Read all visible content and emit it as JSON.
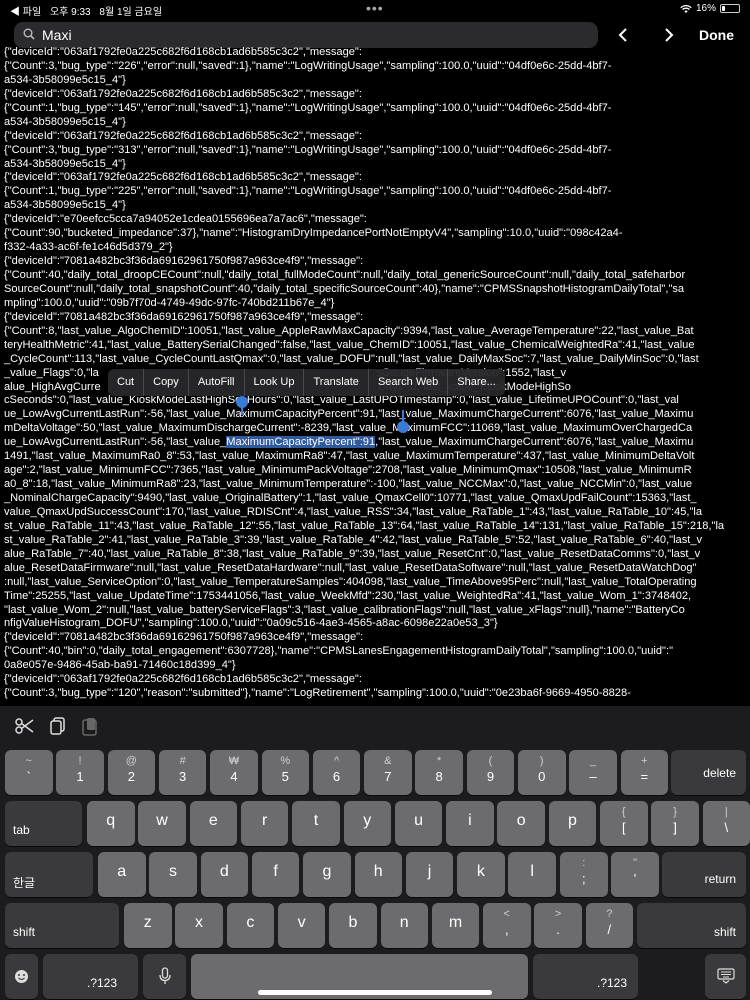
{
  "status_bar": {
    "back_app": "◀ 파일",
    "time": "오후 9:33",
    "date": "8월 1일 금요일",
    "battery": "16%",
    "battery_level": 0.16
  },
  "find_bar": {
    "query": "Maxi",
    "done_label": "Done"
  },
  "log_lines": [
    "{\"deviceId\":\"063af1792fe0a225c682f6d168cb1ad6b585c3c2\",\"message\":",
    "{\"Count\":3,\"bug_type\":\"226\",\"error\":null,\"saved\":1},\"name\":\"LogWritingUsage\",\"sampling\":100.0,\"uuid\":\"04df0e6c-25dd-4bf7-",
    "a534-3b58099e5c15_4\"}",
    "{\"deviceId\":\"063af1792fe0a225c682f6d168cb1ad6b585c3c2\",\"message\":",
    "{\"Count\":1,\"bug_type\":\"145\",\"error\":null,\"saved\":1},\"name\":\"LogWritingUsage\",\"sampling\":100.0,\"uuid\":\"04df0e6c-25dd-4bf7-",
    "a534-3b58099e5c15_4\"}",
    "{\"deviceId\":\"063af1792fe0a225c682f6d168cb1ad6b585c3c2\",\"message\":",
    "{\"Count\":3,\"bug_type\":\"313\",\"error\":null,\"saved\":1},\"name\":\"LogWritingUsage\",\"sampling\":100.0,\"uuid\":\"04df0e6c-25dd-4bf7-",
    "a534-3b58099e5c15_4\"}",
    "{\"deviceId\":\"063af1792fe0a225c682f6d168cb1ad6b585c3c2\",\"message\":",
    "{\"Count\":1,\"bug_type\":\"225\",\"error\":null,\"saved\":1},\"name\":\"LogWritingUsage\",\"sampling\":100.0,\"uuid\":\"04df0e6c-25dd-4bf7-",
    "a534-3b58099e5c15_4\"}",
    "{\"deviceId\":\"e70eefcc5cca7a94052e1cdea0155696ea7a7ac6\",\"message\":",
    "{\"Count\":90,\"bucketed_impedance\":37},\"name\":\"HistogramDryImpedancePortNotEmptyV4\",\"sampling\":10.0,\"uuid\":\"098c42a4-",
    "f332-4a33-ac6f-fe1c46d5d379_2\"}",
    "{\"deviceId\":\"7081a482bc3f36da69162961750f987a963ce4f9\",\"message\":",
    "{\"Count\":40,\"daily_total_droopCECount\":null,\"daily_total_fullModeCount\":null,\"daily_total_genericSourceCount\":null,\"daily_total_safeharbor",
    "SourceCount\":null,\"daily_total_snapshotCount\":40,\"daily_total_specificSourceCount\":40},\"name\":\"CPMSSnapshotHistogramDailyTotal\",\"sa",
    "mpling\":100.0,\"uuid\":\"09b7f70d-4749-49dc-97fc-740bd211b67e_4\"}",
    "{\"deviceId\":\"7081a482bc3f36da69162961750f987a963ce4f9\",\"message\":",
    "{\"Count\":8,\"last_value_AlgoChemID\":10051,\"last_value_AppleRawMaxCapacity\":9394,\"last_value_AverageTemperature\":22,\"last_value_Bat",
    "teryHealthMetric\":41,\"last_value_BatterySerialChanged\":false,\"last_value_ChemID\":10051,\"last_value_ChemicalWeightedRa\":41,\"last_value",
    "_CycleCount\":113,\"last_value_CycleCountLastQmax\":0,\"last_value_DOFU\":null,\"last_value_DailyMaxSoc\":7,\"last_value_DailyMinSoc\":0,\"last",
    "_value_Flags\":0,\"la                                                                                          sGaugeFirmwareVersion\":1552,\"last_v",
    "alue_HighAvgCurre                                                                                          Days\":0,\"last_value_KioskModeHighSo",
    "cSeconds\":0,\"last_value_KioskModeLastHighSocHours\":0,\"last_value_LastUPOTimestamp\":0,\"last_value_LifetimeUPOCount\":0,\"last_val",
    "ue_LowAvgCurrentLastRun\":-56,\"last_value_MaximumCapacityPercent\":91,\"last_value_MaximumChargeCurrent\":6076,\"last_value_Maximu",
    "mDeltaVoltage\":50,\"last_value_MaximumDischargeCurrent\":-8239,\"last_value_MaximumFCC\":11069,\"last_value_MaximumOverChargedCa",
    "pacity\":1599,\"last_value_MaximumOverDischargedCapacity\":-802,\"last_value_MaximumPackVoltage\":4402,\"last_value_MaximumQmax\":1",
    "1491,\"last_value_MaximumRa0_8\":53,\"last_value_MaximumRa8\":47,\"last_value_MaximumTemperature\":437,\"last_value_MinimumDeltaVolt",
    "age\":2,\"last_value_MinimumFCC\":7365,\"last_value_MinimumPackVoltage\":2708,\"last_value_MinimumQmax\":10508,\"last_value_MinimumR",
    "a0_8\":18,\"last_value_MinimumRa8\":23,\"last_value_MinimumTemperature\":-100,\"last_value_NCCMax\":0,\"last_value_NCCMin\":0,\"last_value",
    "_NominalChargeCapacity\":9490,\"last_value_OriginalBattery\":1,\"last_value_QmaxCell0\":10771,\"last_value_QmaxUpdFailCount\":15363,\"last_",
    "value_QmaxUpdSuccessCount\":170,\"last_value_RDISCnt\":4,\"last_value_RSS\":34,\"last_value_RaTable_1\":43,\"last_value_RaTable_10\":45,\"la",
    "st_value_RaTable_11\":43,\"last_value_RaTable_12\":55,\"last_value_RaTable_13\":64,\"last_value_RaTable_14\":131,\"last_value_RaTable_15\":218,\"la",
    "st_value_RaTable_2\":41,\"last_value_RaTable_3\":39,\"last_value_RaTable_4\":42,\"last_value_RaTable_5\":52,\"last_value_RaTable_6\":40,\"last_v",
    "alue_RaTable_7\":40,\"last_value_RaTable_8\":38,\"last_value_RaTable_9\":39,\"last_value_ResetCnt\":0,\"last_value_ResetDataComms\":0,\"last_v",
    "alue_ResetDataFirmware\":null,\"last_value_ResetDataHardware\":null,\"last_value_ResetDataSoftware\":null,\"last_value_ResetDataWatchDog\"",
    ":null,\"last_value_ServiceOption\":0,\"last_value_TemperatureSamples\":404098,\"last_value_TimeAbove95Perc\":null,\"last_value_TotalOperating",
    "Time\":25255,\"last_value_UpdateTime\":1753441056,\"last_value_WeekMfd\":230,\"last_value_WeightedRa\":41,\"last_value_Wom_1\":3748402,",
    "\"last_value_Wom_2\":null,\"last_value_batteryServiceFlags\":3,\"last_value_calibrationFlags\":null,\"last_value_xFlags\":null},\"name\":\"BatteryCo",
    "nfigValueHistogram_DOFU\",\"sampling\":100.0,\"uuid\":\"0a09c516-4ae3-4565-a8ac-6098e22a0e53_3\"}",
    "{\"deviceId\":\"7081a482bc3f36da69162961750f987a963ce4f9\",\"message\":",
    "{\"Count\":40,\"bin\":0,\"daily_total_engagement\":6307728},\"name\":\"CPMSLanesEngagementHistogramDailyTotal\",\"sampling\":100.0,\"uuid\":\"",
    "0a8e057e-9486-45ab-ba91-71460c18d399_4\"}",
    "{\"deviceId\":\"063af1792fe0a225c682f6d168cb1ad6b585c3c2\",\"message\":",
    "{\"Count\":3,\"bug_type\":\"120\",\"reason\":\"submitted\"},\"name\":\"LogRetirement\",\"sampling\":100.0,\"uuid\":\"0e23ba6f-9669-4950-8828-"
  ],
  "highlight": {
    "line_index": 28,
    "before": "ue_LowAvgCurrentLastRun\":-56,\"last_value_",
    "selected": "MaximumCapacityPercent\":91",
    "after": ",\"last_value_MaximumChargeCurrent\":6076,\"last_value_Maximu"
  },
  "edit_menu": [
    "Cut",
    "Copy",
    "AutoFill",
    "Look Up",
    "Translate",
    "Search Web",
    "Share..."
  ],
  "shortcut_icons": [
    "scissors-icon",
    "copy-icon",
    "paste-icon"
  ],
  "keyboard": {
    "row1": [
      {
        "top": "~",
        "bottom": "`"
      },
      {
        "top": "!",
        "bottom": "1"
      },
      {
        "top": "@",
        "bottom": "2"
      },
      {
        "top": "#",
        "bottom": "3"
      },
      {
        "top": "₩",
        "bottom": "4"
      },
      {
        "top": "%",
        "bottom": "5"
      },
      {
        "top": "^",
        "bottom": "6"
      },
      {
        "top": "&",
        "bottom": "7"
      },
      {
        "top": "*",
        "bottom": "8"
      },
      {
        "top": "(",
        "bottom": "9"
      },
      {
        "top": ")",
        "bottom": "0"
      },
      {
        "top": "_",
        "bottom": "–"
      },
      {
        "top": "+",
        "bottom": "="
      }
    ],
    "delete": "delete",
    "tab": "tab",
    "row2": [
      "q",
      "w",
      "e",
      "r",
      "t",
      "y",
      "u",
      "i",
      "o",
      "p"
    ],
    "row2_extra": [
      {
        "top": "{",
        "bottom": "["
      },
      {
        "top": "}",
        "bottom": "]"
      },
      {
        "top": "|",
        "bottom": "\\"
      }
    ],
    "lang": "한글",
    "row3": [
      "a",
      "s",
      "d",
      "f",
      "g",
      "h",
      "j",
      "k",
      "l"
    ],
    "row3_extra": [
      {
        "top": ":",
        "bottom": ";"
      },
      {
        "top": "\"",
        "bottom": "'"
      }
    ],
    "return": "return",
    "shift_left": "shift",
    "row4": [
      "z",
      "x",
      "c",
      "v",
      "b",
      "n",
      "m"
    ],
    "row4_extra": [
      {
        "top": "<",
        "bottom": ","
      },
      {
        "top": ">",
        "bottom": "."
      },
      {
        "top": "?",
        "bottom": "/"
      }
    ],
    "shift_right": "shift",
    "numbers_left": ".?123",
    "numbers_right": ".?123"
  }
}
